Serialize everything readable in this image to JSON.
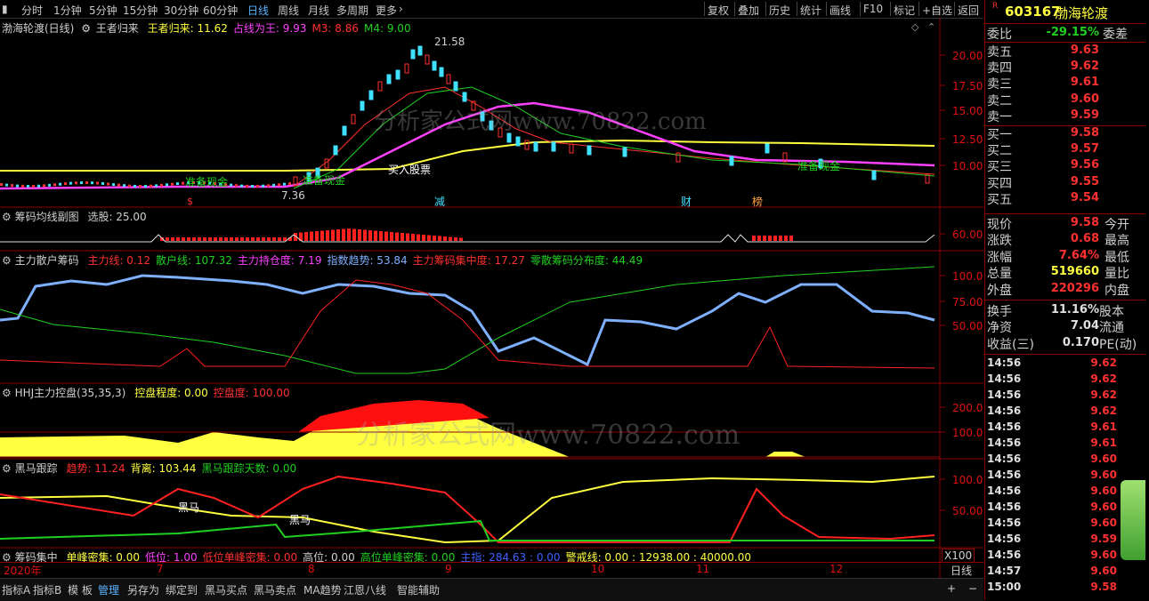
{
  "topbar": {
    "periods": [
      "分时",
      "1分钟",
      "5分钟",
      "15分钟",
      "30分钟",
      "60分钟",
      "日线",
      "周线",
      "月线",
      "多周期",
      "更多"
    ],
    "active": "日线",
    "tools": [
      "复权",
      "叠加",
      "历史",
      "统计",
      "画线",
      "F10",
      "标记",
      "+自选",
      "返回"
    ]
  },
  "main_panel": {
    "stock_label": "渤海轮渡(日线)",
    "indicator": "王者归来",
    "params": [
      {
        "label": "王者归来: ",
        "value": "11.62",
        "color": "#ffff40"
      },
      {
        "label": "占线为王: ",
        "value": "9.93",
        "color": "#ff40ff"
      },
      {
        "label": "M3: ",
        "value": "8.86",
        "color": "#ff3030"
      },
      {
        "label": "M4: ",
        "value": "9.00",
        "color": "#20d020"
      }
    ],
    "yticks": [
      "20.00",
      "17.50",
      "15.00",
      "12.50",
      "10.00"
    ],
    "annotations": {
      "high": "21.58",
      "low": "7.36",
      "buy": "买入股票",
      "prep1": "准备现金",
      "prep2": "准备现金",
      "prep3": "准备现金",
      "mark1": "减",
      "mark2": "财",
      "mark3": "榜",
      "mark4": "$"
    }
  },
  "panel2": {
    "title": "筹码均线副图",
    "params": [
      {
        "label": "选股: ",
        "value": "25.00",
        "color": "#d0d0d0"
      }
    ],
    "yticks": [
      "60.00"
    ]
  },
  "panel3": {
    "title": "主力散户筹码",
    "params": [
      {
        "label": "主力线: ",
        "value": "0.12",
        "color": "#ff3030"
      },
      {
        "label": "散户线: ",
        "value": "107.32",
        "color": "#20d020"
      },
      {
        "label": "主力持仓度: ",
        "value": "7.19",
        "color": "#ff40ff"
      },
      {
        "label": "指数趋势: ",
        "value": "53.84",
        "color": "#7fb0ff"
      },
      {
        "label": "主力筹码集中度: ",
        "value": "17.27",
        "color": "#ff3030"
      },
      {
        "label": "零散筹码分布度: ",
        "value": "44.49",
        "color": "#20d020"
      }
    ],
    "yticks": [
      "100.0",
      "75.00",
      "50.00"
    ]
  },
  "panel4": {
    "title": "HHJ主力控盘(35,35,3)",
    "params": [
      {
        "label": "控盘程度: ",
        "value": "0.00",
        "color": "#ffff40"
      },
      {
        "label": "控盘度: ",
        "value": "100.00",
        "color": "#ff3030"
      }
    ],
    "yticks": [
      "200.0",
      "100.0"
    ]
  },
  "panel5": {
    "title": "黑马跟踪",
    "params": [
      {
        "label": "趋势: ",
        "value": "11.24",
        "color": "#ff3030"
      },
      {
        "label": "背离: ",
        "value": "103.44",
        "color": "#ffff40"
      },
      {
        "label": "黑马跟踪天数: ",
        "value": "0.00",
        "color": "#20d020"
      }
    ],
    "yticks": [
      "100.0",
      "50.00"
    ],
    "marks": [
      "黑马",
      "黑马"
    ]
  },
  "panel6": {
    "title": "筹码集中",
    "params": [
      {
        "label": "单峰密集: ",
        "value": "0.00",
        "color": "#ffff40"
      },
      {
        "label": "低位: ",
        "value": "1.00",
        "color": "#ff40ff"
      },
      {
        "label": "低位单峰密集: ",
        "value": "0.00",
        "color": "#ff3030"
      },
      {
        "label": "高位: ",
        "value": "0.00",
        "color": "#d0d0d0"
      },
      {
        "label": "高位单峰密集: ",
        "value": "0.00",
        "color": "#20d020"
      },
      {
        "label": "主指: ",
        "value": "284.63 : 0.00",
        "color": "#4060ff"
      },
      {
        "label": "警戒线: ",
        "value": "0.00 : 12938.00 : 40000.00",
        "color": "#ffff40"
      }
    ],
    "scale": "X100"
  },
  "dates": [
    "2020年",
    "7",
    "8",
    "9",
    "10",
    "11",
    "12"
  ],
  "period_label": "日线",
  "bottom_tabs": [
    "指标A",
    "指标B",
    "模 板",
    "管理",
    "另存为",
    "绑定到",
    "黑马买点",
    "黑马卖点",
    "MA趋势",
    "江恩八线",
    "智能辅助"
  ],
  "bottom_active": "管理",
  "right": {
    "code": "603167",
    "name": "渤海轮渡",
    "weibi_label": "委比",
    "weibi_value": "-29.15%",
    "weicha_label": "委差",
    "sells": [
      {
        "label": "卖五",
        "price": "9.63"
      },
      {
        "label": "卖四",
        "price": "9.62"
      },
      {
        "label": "卖三",
        "price": "9.61"
      },
      {
        "label": "卖二",
        "price": "9.60"
      },
      {
        "label": "卖一",
        "price": "9.59"
      }
    ],
    "buys": [
      {
        "label": "买一",
        "price": "9.58"
      },
      {
        "label": "买二",
        "price": "9.57"
      },
      {
        "label": "买三",
        "price": "9.56"
      },
      {
        "label": "买四",
        "price": "9.55"
      },
      {
        "label": "买五",
        "price": "9.54"
      }
    ],
    "quote": [
      {
        "label": "现价",
        "value": "9.58",
        "color": "#ff3030",
        "label2": "今开"
      },
      {
        "label": "涨跌",
        "value": "0.68",
        "color": "#ff3030",
        "label2": "最高"
      },
      {
        "label": "涨幅",
        "value": "7.64%",
        "color": "#ff3030",
        "label2": "最低"
      },
      {
        "label": "总量",
        "value": "519660",
        "color": "#ffff40",
        "label2": "量比"
      },
      {
        "label": "外盘",
        "value": "220296",
        "color": "#ff3030",
        "label2": "内盘"
      }
    ],
    "quote2": [
      {
        "label": "换手",
        "value": "11.16%",
        "color": "#e0e0e0",
        "label2": "股本"
      },
      {
        "label": "净资",
        "value": "7.04",
        "color": "#e0e0e0",
        "label2": "流通"
      },
      {
        "label": "收益(三)",
        "value": "0.170",
        "color": "#e0e0e0",
        "label2": "PE(动)"
      }
    ],
    "ticks": [
      {
        "time": "14:56",
        "price": "9.62"
      },
      {
        "time": "14:56",
        "price": "9.62"
      },
      {
        "time": "14:56",
        "price": "9.62"
      },
      {
        "time": "14:56",
        "price": "9.62"
      },
      {
        "time": "14:56",
        "price": "9.61"
      },
      {
        "time": "14:56",
        "price": "9.61"
      },
      {
        "time": "14:56",
        "price": "9.60"
      },
      {
        "time": "14:56",
        "price": "9.60"
      },
      {
        "time": "14:56",
        "price": "9.60"
      },
      {
        "time": "14:56",
        "price": "9.60"
      },
      {
        "time": "14:56",
        "price": "9.60"
      },
      {
        "time": "14:56",
        "price": "9.59"
      },
      {
        "time": "14:56",
        "price": "9.60"
      },
      {
        "time": "14:57",
        "price": "9.60"
      },
      {
        "time": "15:00",
        "price": "9.58"
      }
    ]
  },
  "watermark": "分析家公式网www.70822.com"
}
